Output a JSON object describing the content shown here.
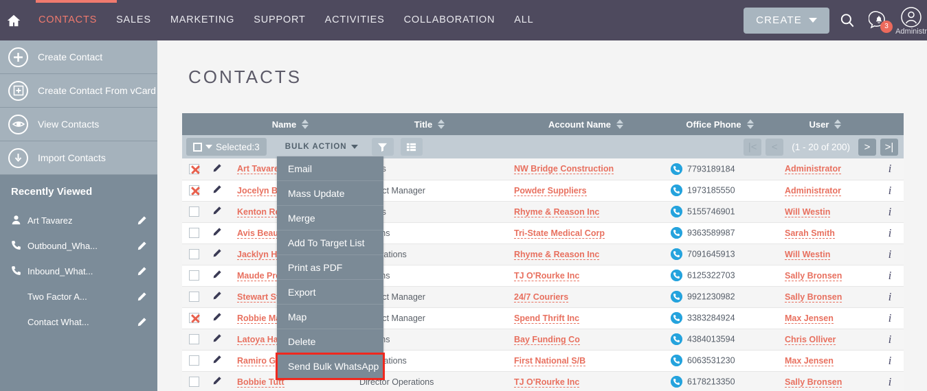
{
  "topnav": {
    "home_icon": "home-icon",
    "items": [
      {
        "label": "CONTACTS",
        "active": true
      },
      {
        "label": "SALES",
        "active": false
      },
      {
        "label": "MARKETING",
        "active": false
      },
      {
        "label": "SUPPORT",
        "active": false
      },
      {
        "label": "ACTIVITIES",
        "active": false
      },
      {
        "label": "COLLABORATION",
        "active": false
      },
      {
        "label": "ALL",
        "active": false
      }
    ],
    "create_label": "CREATE",
    "notification_count": "3",
    "user_label": "Administr",
    "accent_color": "#f07a6e",
    "bar_color": "#4e4a5e"
  },
  "sidebar": {
    "actions": [
      {
        "label": "Create Contact",
        "icon": "plus-circle-icon"
      },
      {
        "label": "Create Contact From vCard",
        "icon": "plus-square-circle-icon"
      },
      {
        "label": "View Contacts",
        "icon": "eye-circle-icon"
      },
      {
        "label": "Import Contacts",
        "icon": "download-circle-icon"
      }
    ],
    "recent_header": "Recently Viewed",
    "recent_items": [
      {
        "label": "Art Tavarez",
        "icon": "person-icon"
      },
      {
        "label": "Outbound_Wha...",
        "icon": "phone-icon"
      },
      {
        "label": "Inbound_What...",
        "icon": "phone-icon"
      },
      {
        "label": "Two Factor A...",
        "icon": ""
      },
      {
        "label": "Contact What...",
        "icon": ""
      }
    ]
  },
  "main": {
    "page_title": "CONTACTS",
    "columns": [
      {
        "label": "Name"
      },
      {
        "label": "Title"
      },
      {
        "label": "Account Name"
      },
      {
        "label": "Office Phone"
      },
      {
        "label": "User"
      }
    ],
    "toolbar": {
      "selected_label": "Selected:3",
      "bulk_action_label": "BULK ACTION",
      "filter_icon": "filter-icon",
      "columns_icon": "column-chooser-icon",
      "pagination_label": "(1 - 20 of 200)"
    },
    "bulk_menu": [
      {
        "label": "Email",
        "highlighted": false
      },
      {
        "label": "Mass Update",
        "highlighted": false
      },
      {
        "label": "Merge",
        "highlighted": false
      },
      {
        "label": "Add To Target List",
        "highlighted": false
      },
      {
        "label": "Print as PDF",
        "highlighted": false
      },
      {
        "label": "Export",
        "highlighted": false
      },
      {
        "label": "Map",
        "highlighted": false
      },
      {
        "label": "Delete",
        "highlighted": false
      },
      {
        "label": "Send Bulk WhatsApp",
        "highlighted": true
      }
    ],
    "rows": [
      {
        "checked": true,
        "name": "Art Tavarez",
        "title": "Director Sales",
        "title_visible": "r Sales",
        "account": "NW Bridge Construction",
        "phone": "7793189184",
        "user": "Administrator"
      },
      {
        "checked": true,
        "name": "Jocelyn Ba",
        "title": "Product Manager",
        "title_visible": "Product Manager",
        "account": "Powder Suppliers",
        "phone": "1973185550",
        "user": "Administrator"
      },
      {
        "checked": false,
        "name": "Kenton Ro",
        "title": "Director Sales",
        "title_visible": "r Sales",
        "account": "Rhyme & Reason Inc",
        "phone": "5155746901",
        "user": "Will Westin"
      },
      {
        "checked": false,
        "name": "Avis Beau",
        "title": "Director Operations",
        "title_visible": "erations",
        "account": "Tri-State Medical Corp",
        "phone": "9363589987",
        "user": "Sarah Smith"
      },
      {
        "checked": false,
        "name": "Jacklyn Ha",
        "title": "Director Operations",
        "title_visible": "r Operations",
        "account": "Rhyme & Reason Inc",
        "phone": "7091645913",
        "user": "Will Westin"
      },
      {
        "checked": false,
        "name": "Maude Pre",
        "title": "Director Operations",
        "title_visible": "erations",
        "account": "TJ O'Rourke Inc",
        "phone": "6125322703",
        "user": "Sally Bronsen"
      },
      {
        "checked": false,
        "name": "Stewart St",
        "title": "Product Manager",
        "title_visible": "Product Manager",
        "account": "24/7 Couriers",
        "phone": "9921230982",
        "user": "Sally Bronsen"
      },
      {
        "checked": true,
        "name": "Robbie Ma",
        "title": "Product Manager",
        "title_visible": "Product Manager",
        "account": "Spend Thrift Inc",
        "phone": "3383284924",
        "user": "Max Jensen"
      },
      {
        "checked": false,
        "name": "Latoya Ha",
        "title": "Director Operations",
        "title_visible": "erations",
        "account": "Bay Funding Co",
        "phone": "4384013594",
        "user": "Chris Olliver"
      },
      {
        "checked": false,
        "name": "Ramiro Gi",
        "title": "Director Operations",
        "title_visible": "r Operations",
        "account": "First National S/B",
        "phone": "6063531230",
        "user": "Max Jensen"
      },
      {
        "checked": false,
        "name": "Bobbie Tutt",
        "title": "Director Operations",
        "title_visible": "Director Operations",
        "account": "TJ O'Rourke Inc",
        "phone": "6178213350",
        "user": "Sally Bronsen"
      }
    ]
  }
}
